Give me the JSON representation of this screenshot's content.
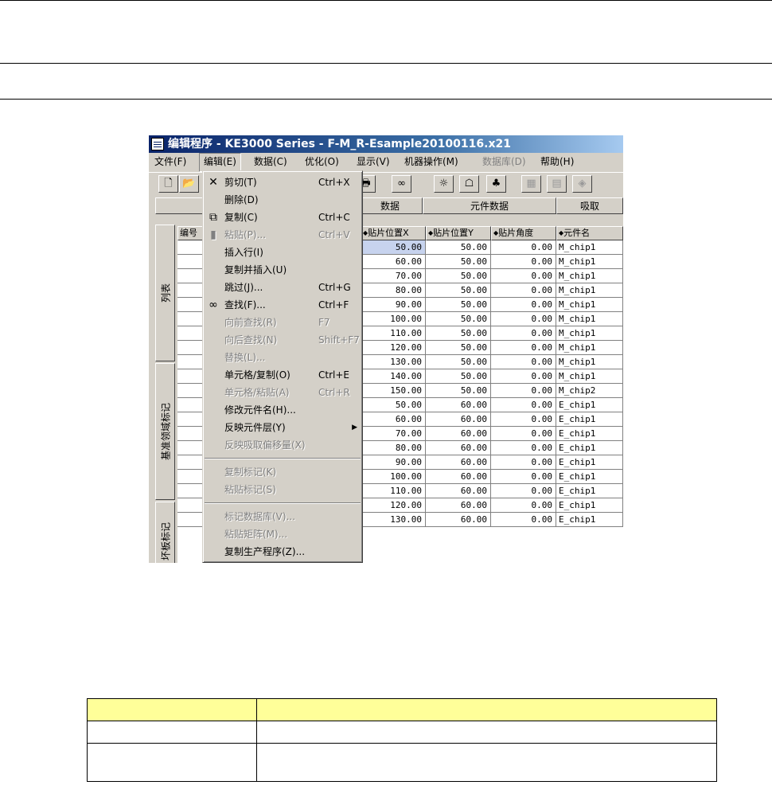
{
  "window": {
    "title": "编辑程序 - KE3000 Series - F-M_R-Esample20100116.x21"
  },
  "menubar": [
    {
      "label": "文件(F)",
      "state": "normal"
    },
    {
      "label": "编辑(E)",
      "state": "open"
    },
    {
      "label": "数据(C)",
      "state": "normal"
    },
    {
      "label": "优化(O)",
      "state": "normal"
    },
    {
      "label": "显示(V)",
      "state": "normal"
    },
    {
      "label": "机器操作(M)",
      "state": "normal"
    },
    {
      "label": "数据库(D)",
      "state": "disabled"
    },
    {
      "label": "帮助(H)",
      "state": "normal"
    }
  ],
  "toolbar": {
    "icons": [
      "new-file-icon",
      "open-folder-icon",
      "print-icon",
      "find-binoculars-icon",
      "lightbulb-icon",
      "teach-icon",
      "components-icon",
      "feeder-icon",
      "tray-icon",
      "package-icon"
    ]
  },
  "tabs": [
    "",
    "数据",
    "元件数据",
    "吸取"
  ],
  "side_tabs": [
    "列表",
    "基准领域标记",
    "坏板标记"
  ],
  "grid": {
    "header_first": "编号",
    "columns": [
      "贴片位置X",
      "贴片位置Y",
      "贴片角度",
      "元件名"
    ],
    "rows": [
      [
        "50.00",
        "50.00",
        "0.00",
        "M_chip1"
      ],
      [
        "60.00",
        "50.00",
        "0.00",
        "M_chip1"
      ],
      [
        "70.00",
        "50.00",
        "0.00",
        "M_chip1"
      ],
      [
        "80.00",
        "50.00",
        "0.00",
        "M_chip1"
      ],
      [
        "90.00",
        "50.00",
        "0.00",
        "M_chip1"
      ],
      [
        "100.00",
        "50.00",
        "0.00",
        "M_chip1"
      ],
      [
        "110.00",
        "50.00",
        "0.00",
        "M_chip1"
      ],
      [
        "120.00",
        "50.00",
        "0.00",
        "M_chip1"
      ],
      [
        "130.00",
        "50.00",
        "0.00",
        "M_chip1"
      ],
      [
        "140.00",
        "50.00",
        "0.00",
        "M_chip1"
      ],
      [
        "150.00",
        "50.00",
        "0.00",
        "M_chip2"
      ],
      [
        "50.00",
        "60.00",
        "0.00",
        "E_chip1"
      ],
      [
        "60.00",
        "60.00",
        "0.00",
        "E_chip1"
      ],
      [
        "70.00",
        "60.00",
        "0.00",
        "E_chip1"
      ],
      [
        "80.00",
        "60.00",
        "0.00",
        "E_chip1"
      ],
      [
        "90.00",
        "60.00",
        "0.00",
        "E_chip1"
      ],
      [
        "100.00",
        "60.00",
        "0.00",
        "E_chip1"
      ],
      [
        "110.00",
        "60.00",
        "0.00",
        "E_chip1"
      ],
      [
        "120.00",
        "60.00",
        "0.00",
        "E_chip1"
      ],
      [
        "130.00",
        "60.00",
        "0.00",
        "E_chip1"
      ]
    ]
  },
  "edit_menu": [
    {
      "label": "剪切(T)",
      "shortcut": "Ctrl+X",
      "icon": "cut-icon",
      "disabled": false
    },
    {
      "label": "删除(D)",
      "shortcut": "",
      "icon": "",
      "disabled": false
    },
    {
      "label": "复制(C)",
      "shortcut": "Ctrl+C",
      "icon": "copy-icon",
      "disabled": false
    },
    {
      "label": "粘贴(P)...",
      "shortcut": "Ctrl+V",
      "icon": "paste-icon",
      "disabled": true
    },
    {
      "label": "插入行(I)",
      "shortcut": "",
      "icon": "",
      "disabled": false
    },
    {
      "label": "复制并插入(U)",
      "shortcut": "",
      "icon": "",
      "disabled": false
    },
    {
      "label": "跳过(J)...",
      "shortcut": "Ctrl+G",
      "icon": "",
      "disabled": false
    },
    {
      "label": "查找(F)...",
      "shortcut": "Ctrl+F",
      "icon": "find-binoculars-icon",
      "disabled": false
    },
    {
      "label": "向前查找(R)",
      "shortcut": "F7",
      "icon": "",
      "disabled": true
    },
    {
      "label": "向后查找(N)",
      "shortcut": "Shift+F7",
      "icon": "",
      "disabled": true
    },
    {
      "label": "替换(L)...",
      "shortcut": "",
      "icon": "",
      "disabled": true
    },
    {
      "label": "单元格/复制(O)",
      "shortcut": "Ctrl+E",
      "icon": "",
      "disabled": false
    },
    {
      "label": "单元格/粘贴(A)",
      "shortcut": "Ctrl+R",
      "icon": "",
      "disabled": true
    },
    {
      "label": "修改元件名(H)...",
      "shortcut": "",
      "icon": "",
      "disabled": false
    },
    {
      "label": "反映元件层(Y)",
      "shortcut": "",
      "icon": "",
      "disabled": false,
      "submenu": true
    },
    {
      "label": "反映吸取偏移量(X)",
      "shortcut": "",
      "icon": "",
      "disabled": true
    },
    {
      "separator": true
    },
    {
      "label": "复制标记(K)",
      "shortcut": "",
      "icon": "",
      "disabled": true
    },
    {
      "label": "粘贴标记(S)",
      "shortcut": "",
      "icon": "",
      "disabled": true
    },
    {
      "separator": true
    },
    {
      "label": "标记数据库(V)...",
      "shortcut": "",
      "icon": "",
      "disabled": true
    },
    {
      "label": "粘贴矩阵(M)...",
      "shortcut": "",
      "icon": "",
      "disabled": true
    },
    {
      "label": "复制生产程序(Z)...",
      "shortcut": "",
      "icon": "",
      "disabled": false
    }
  ],
  "colors": {
    "title_start": "#0a246a",
    "title_end": "#a6caf0",
    "selected_cell": "#c7d3ee",
    "table_header": "#ffff99"
  }
}
